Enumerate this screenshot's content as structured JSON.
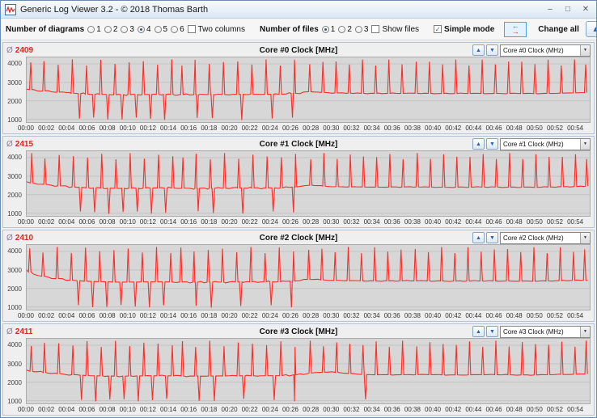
{
  "window": {
    "title": "Generic Log Viewer 3.2 - © 2018 Thomas Barth"
  },
  "icons": {
    "minimize": "–",
    "maximize": "□",
    "close": "✕",
    "up_arrow": "▲",
    "down_arrow": "▼",
    "dropdown": "▼",
    "check": "✓",
    "swap_left": "←",
    "swap_right": "→"
  },
  "toolbar": {
    "diagrams": {
      "label": "Number of diagrams",
      "options": [
        "1",
        "2",
        "3",
        "4",
        "5",
        "6"
      ],
      "selected": "4",
      "two_columns": {
        "label": "Two columns",
        "checked": false
      }
    },
    "files": {
      "label": "Number of files",
      "options": [
        "1",
        "2",
        "3"
      ],
      "selected": "1",
      "show_files": {
        "label": "Show files",
        "checked": false
      }
    },
    "simple_mode": {
      "label": "Simple mode",
      "checked": true
    },
    "change_all": {
      "label": "Change all"
    }
  },
  "panel": {
    "avg_prefix": "Ø"
  },
  "axis": {
    "x_ticks": [
      "00:00",
      "00:02",
      "00:04",
      "00:06",
      "00:08",
      "00:10",
      "00:12",
      "00:14",
      "00:16",
      "00:18",
      "00:20",
      "00:22",
      "00:24",
      "00:26",
      "00:28",
      "00:30",
      "00:32",
      "00:34",
      "00:36",
      "00:38",
      "00:40",
      "00:42",
      "00:44",
      "00:46",
      "00:48",
      "00:50",
      "00:52",
      "00:54"
    ],
    "y_ticks": [
      "4000",
      "3000",
      "2000",
      "1000"
    ],
    "x_max_minutes": 55.5,
    "vmin": 850,
    "vmax": 4350
  },
  "chart_data": [
    {
      "type": "line",
      "title": "Core #0 Clock [MHz]",
      "unit": "MHz",
      "avg": 2409,
      "avg_display": "2409",
      "selector": "Core #0 Clock (MHz)",
      "series_color": "#ff2b25",
      "ylim": [
        850,
        4350
      ],
      "xlim_minutes": [
        0,
        55.5
      ],
      "baseline_points": [
        [
          0,
          2630
        ],
        [
          2,
          2520
        ],
        [
          4,
          2430
        ],
        [
          6,
          2360
        ],
        [
          9,
          2330
        ],
        [
          13,
          2350
        ],
        [
          17,
          2330
        ],
        [
          21,
          2350
        ],
        [
          25,
          2360
        ],
        [
          27,
          2420
        ],
        [
          28,
          2500
        ],
        [
          30,
          2430
        ],
        [
          34,
          2400
        ],
        [
          38,
          2410
        ],
        [
          42,
          2395
        ],
        [
          46,
          2405
        ],
        [
          50,
          2390
        ],
        [
          53,
          2420
        ],
        [
          55.5,
          2450
        ]
      ],
      "spike_times": [
        0.4,
        1.7,
        3.1,
        4.5,
        5.9,
        7.3,
        8.7,
        10.1,
        11.5,
        12.9,
        14.3,
        15.3,
        16.6,
        18.0,
        19.4,
        20.8,
        22.2,
        23.6,
        25.0,
        26.4,
        27.9,
        29.2,
        30.5,
        31.8,
        33.1,
        34.4,
        35.7,
        37.0,
        38.4,
        39.7,
        41.0,
        42.3,
        43.6,
        44.9,
        46.2,
        47.5,
        48.8,
        50.1,
        51.4,
        52.7,
        54.0,
        55.1
      ],
      "spike_value": 4080,
      "dip_times": [
        5.2,
        6.6,
        8.0,
        9.4,
        10.8,
        12.2,
        13.6,
        16.8,
        18.3,
        21.2,
        24.2,
        26.2
      ],
      "dip_value": 1030
    },
    {
      "type": "line",
      "title": "Core #1 Clock [MHz]",
      "unit": "MHz",
      "avg": 2415,
      "avg_display": "2415",
      "selector": "Core #1 Clock (MHz)",
      "series_color": "#ff2b25",
      "ylim": [
        850,
        4350
      ],
      "xlim_minutes": [
        0,
        55.5
      ],
      "baseline_points": [
        [
          0,
          2660
        ],
        [
          2,
          2540
        ],
        [
          4,
          2440
        ],
        [
          6,
          2370
        ],
        [
          9,
          2340
        ],
        [
          13,
          2360
        ],
        [
          17,
          2340
        ],
        [
          21,
          2355
        ],
        [
          25,
          2365
        ],
        [
          27,
          2430
        ],
        [
          28,
          2510
        ],
        [
          30,
          2435
        ],
        [
          34,
          2405
        ],
        [
          38,
          2415
        ],
        [
          42,
          2400
        ],
        [
          46,
          2410
        ],
        [
          50,
          2395
        ],
        [
          53,
          2425
        ],
        [
          55.5,
          2455
        ]
      ],
      "spike_times": [
        0.5,
        1.8,
        3.2,
        4.6,
        6.0,
        7.4,
        8.8,
        10.2,
        11.6,
        13.0,
        14.4,
        15.4,
        16.7,
        18.1,
        19.5,
        20.9,
        22.3,
        23.7,
        25.1,
        26.5,
        28.0,
        29.3,
        30.6,
        31.9,
        33.2,
        34.5,
        35.8,
        37.1,
        38.5,
        39.8,
        41.1,
        42.4,
        43.7,
        45.0,
        46.3,
        47.6,
        48.9,
        50.2,
        51.5,
        52.8,
        54.1,
        55.2
      ],
      "spike_value": 4080,
      "dip_times": [
        5.3,
        6.7,
        8.1,
        9.5,
        10.9,
        12.3,
        13.7,
        16.9,
        18.4,
        21.3,
        24.3,
        26.3
      ],
      "dip_value": 1030
    },
    {
      "type": "line",
      "title": "Core #2 Clock [MHz]",
      "unit": "MHz",
      "avg": 2410,
      "avg_display": "2410",
      "selector": "Core #2 Clock (MHz)",
      "series_color": "#ff2b25",
      "ylim": [
        850,
        4350
      ],
      "xlim_minutes": [
        0,
        55.5
      ],
      "baseline_points": [
        [
          0,
          2960
        ],
        [
          1,
          2720
        ],
        [
          2.5,
          2570
        ],
        [
          4,
          2460
        ],
        [
          6,
          2380
        ],
        [
          9,
          2340
        ],
        [
          13,
          2355
        ],
        [
          17,
          2335
        ],
        [
          21,
          2350
        ],
        [
          25,
          2360
        ],
        [
          27,
          2425
        ],
        [
          28,
          2505
        ],
        [
          30,
          2430
        ],
        [
          34,
          2400
        ],
        [
          38,
          2410
        ],
        [
          42,
          2395
        ],
        [
          46,
          2405
        ],
        [
          50,
          2390
        ],
        [
          53,
          2420
        ],
        [
          55.5,
          2450
        ]
      ],
      "spike_times": [
        0.3,
        1.6,
        3.0,
        4.4,
        5.8,
        7.2,
        8.6,
        10.0,
        11.4,
        12.8,
        14.2,
        15.2,
        16.5,
        17.9,
        19.3,
        20.7,
        22.1,
        23.5,
        24.9,
        26.3,
        27.8,
        29.1,
        30.4,
        31.7,
        33.0,
        34.3,
        35.6,
        36.9,
        38.3,
        39.6,
        40.9,
        42.2,
        43.5,
        44.8,
        46.1,
        47.4,
        48.7,
        50.0,
        51.3,
        52.6,
        53.9,
        55.0
      ],
      "spike_value": 4080,
      "dip_times": [
        5.1,
        6.5,
        7.9,
        9.3,
        10.7,
        12.1,
        13.5,
        16.7,
        18.2,
        21.1,
        24.1,
        26.1
      ],
      "dip_value": 1030
    },
    {
      "type": "line",
      "title": "Core #3 Clock [MHz]",
      "unit": "MHz",
      "avg": 2411,
      "avg_display": "2411",
      "selector": "Core #3 Clock (MHz)",
      "series_color": "#ff2b25",
      "ylim": [
        850,
        4350
      ],
      "xlim_minutes": [
        0,
        55.5
      ],
      "baseline_points": [
        [
          0,
          2620
        ],
        [
          2,
          2510
        ],
        [
          4,
          2425
        ],
        [
          6,
          2355
        ],
        [
          9,
          2330
        ],
        [
          13,
          2350
        ],
        [
          17,
          2330
        ],
        [
          21,
          2345
        ],
        [
          25,
          2355
        ],
        [
          27,
          2415
        ],
        [
          28,
          2495
        ],
        [
          30,
          2560
        ],
        [
          32,
          2460
        ],
        [
          34,
          2400
        ],
        [
          38,
          2410
        ],
        [
          42,
          2395
        ],
        [
          46,
          2405
        ],
        [
          50,
          2390
        ],
        [
          53,
          2420
        ],
        [
          55.5,
          2450
        ]
      ],
      "spike_times": [
        0.45,
        1.75,
        3.15,
        4.55,
        5.95,
        7.35,
        8.75,
        10.15,
        11.55,
        12.95,
        14.35,
        15.35,
        16.65,
        18.05,
        19.45,
        20.85,
        22.25,
        23.65,
        25.05,
        26.45,
        27.95,
        29.25,
        30.55,
        31.85,
        33.15,
        34.45,
        35.75,
        37.05,
        38.45,
        39.75,
        41.05,
        42.35,
        43.65,
        44.95,
        46.25,
        47.55,
        48.85,
        50.15,
        51.45,
        52.75,
        54.05,
        55.15
      ],
      "spike_value": 4080,
      "dip_times": [
        5.4,
        6.8,
        8.2,
        9.6,
        11.0,
        12.4,
        13.8,
        17.0,
        18.5,
        21.4,
        24.4,
        26.4,
        33.4
      ],
      "dip_value": 1030
    }
  ]
}
